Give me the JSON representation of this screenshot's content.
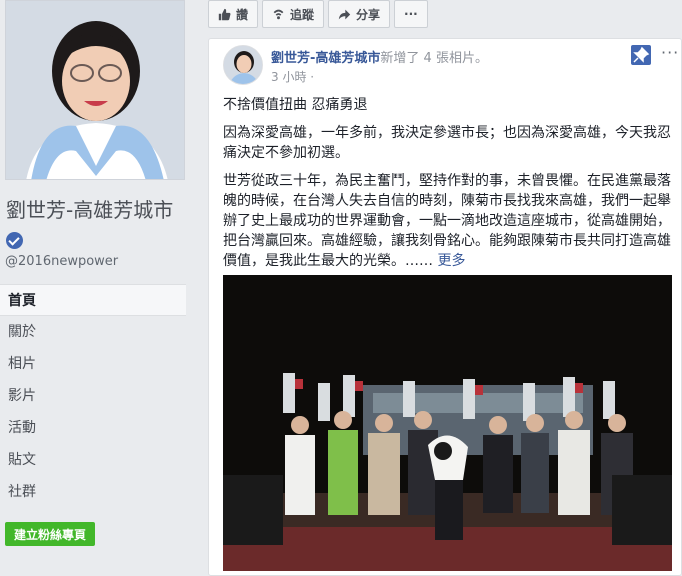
{
  "sidebar": {
    "page_name": "劉世芳-高雄芳城市",
    "handle": "@2016newpower",
    "nav": [
      {
        "label": "首頁"
      },
      {
        "label": "關於"
      },
      {
        "label": "相片"
      },
      {
        "label": "影片"
      },
      {
        "label": "活動"
      },
      {
        "label": "貼文"
      },
      {
        "label": "社群"
      }
    ],
    "create_button": "建立粉絲專頁"
  },
  "action_bar": {
    "like": "讚",
    "follow": "追蹤",
    "share": "分享",
    "more": "···"
  },
  "post": {
    "author": "劉世芳-高雄芳城市",
    "action": "新增了 4 張相片。",
    "time": "3 小時 ·",
    "title": "不捨價值扭曲 忍痛勇退",
    "paragraph1": "因為深愛高雄，一年多前，我決定參選市長；也因為深愛高雄，今天我忍痛決定不參加初選。",
    "paragraph2": "世芳從政三十年，為民主奮鬥，堅持作對的事，未曾畏懼。在民進黨最落魄的時候，在台灣人失去自信的時刻，陳菊市長找我來高雄，我們一起舉辦了史上最成功的世界運動會，一點一滴地改造這座城市，從高雄開始，把台灣贏回來。高雄經驗，讓我刻骨銘心。能夠跟陳菊市長共同打造高雄價值，是我此生最大的光榮。……",
    "more_label": "更多"
  },
  "colors": {
    "link": "#385898",
    "verified": "#4267b2",
    "create_button": "#42b72a"
  }
}
